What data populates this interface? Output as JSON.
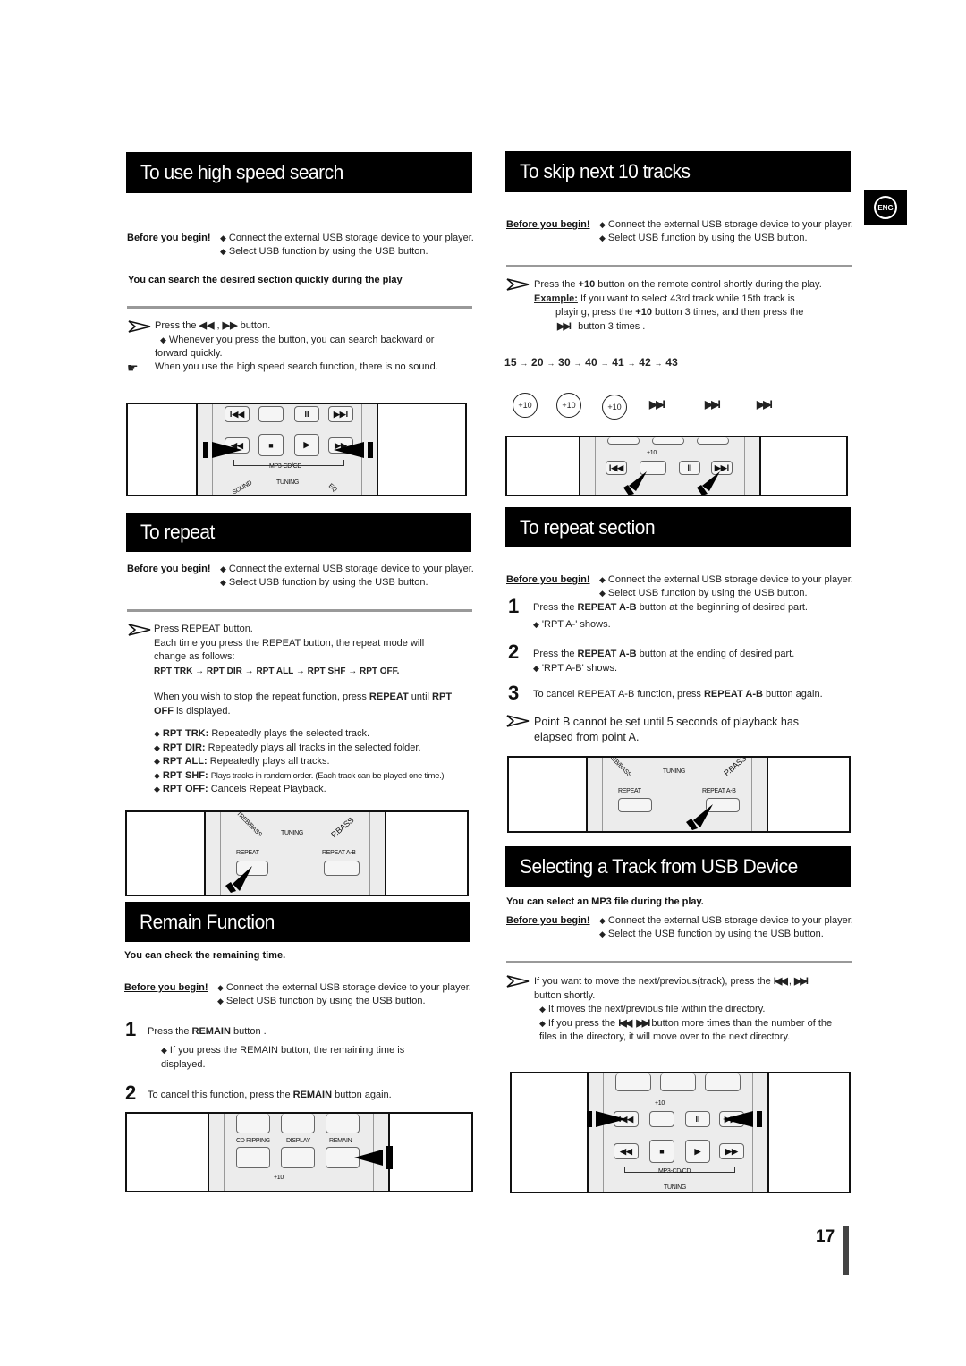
{
  "page_number": "17",
  "lang_badge": "ENG",
  "common": {
    "before_label": "Before you begin!",
    "connect": "Connect the external USB storage device to your player.",
    "select_usb": "Select USB function by using the USB button."
  },
  "high_speed": {
    "title": "To use high speed search",
    "note": "You can search the desired section quickly during the play",
    "press_pre": "Press the",
    "press_post": "button.",
    "bullet": "Whenever you press the button, you can search backward or forward quickly.",
    "hint": "When you use the high speed search function, there is no sound.",
    "remote": {
      "label_mp3": "MP3-CD/CD",
      "label_tuning": "TUNING",
      "label_sound": "SOUND",
      "label_eq": "EQ"
    }
  },
  "repeat": {
    "title": "To repeat",
    "line1": "Press REPEAT button.",
    "line2": "Each time you press the REPEAT button, the repeat mode will change as follows:",
    "sequence": "RPT TRK → RPT DIR → RPT ALL → RPT SHF → RPT OFF.",
    "stop_pre": "When you wish to stop the repeat function, press",
    "stop_b1": "REPEAT",
    "stop_mid": "until",
    "stop_b2": "RPT OFF",
    "stop_post": "is displayed.",
    "modes": [
      {
        "name": "RPT TRK:",
        "desc": "Repeatedly plays the selected track."
      },
      {
        "name": "RPT DIR:",
        "desc": "Repeatedly plays all tracks in the selected folder."
      },
      {
        "name": "RPT ALL:",
        "desc": "Repeatedly plays all tracks."
      },
      {
        "name": "RPT SHF:",
        "desc": "Plays tracks in random order. (Each track can be played one time.)"
      },
      {
        "name": "RPT OFF:",
        "desc": "Cancels Repeat Playback."
      }
    ],
    "remote": {
      "treb": "TREB/BASS",
      "tuning": "TUNING",
      "pbass": "P.BASS",
      "repeat": "REPEAT",
      "repeat_ab": "REPEAT A-B"
    }
  },
  "remain": {
    "title": "Remain Function",
    "note": "You can check the remaining time.",
    "step1_pre": "Press the",
    "step1_b": "REMAIN",
    "step1_post": "button .",
    "step1_bullet": "If you press the REMAIN button, the remaining time is displayed.",
    "step2_pre": "To cancel this function, press the",
    "step2_b": "REMAIN",
    "step2_post": "button again.",
    "remote": {
      "cd_ripping": "CD RIPPING",
      "display": "DISPLAY",
      "remain": "REMAIN",
      "plus10": "+10"
    }
  },
  "skip10": {
    "title": "To skip next 10 tracks",
    "press_pre": "Press the",
    "press_b": "+10",
    "press_post": "button on the remote control shortly during the play.",
    "example_label": "Example:",
    "example_text1": "If you want to select 43rd track while 15th track is",
    "example_text2_pre": "playing, press the",
    "example_text2_b": "+10",
    "example_text2_post": "button 3 times, and then press the",
    "example_text3": "button 3 times .",
    "sequence": [
      "15",
      "20",
      "30",
      "40",
      "41",
      "42",
      "43"
    ],
    "circle_label": "+10",
    "remote": {
      "plus10": "+10"
    }
  },
  "repeat_section": {
    "title": "To repeat section",
    "step1_pre": "Press the",
    "step1_b": "REPEAT A-B",
    "step1_post": "button at the beginning of desired part.",
    "step1_bullet": "'RPT A-' shows.",
    "step2_pre": "Press the",
    "step2_b": "REPEAT A-B",
    "step2_post": "button at the ending of desired part.",
    "step2_bullet": "'RPT A-B' shows.",
    "step3_pre": "To cancel REPEAT A-B function, press",
    "step3_b": "REPEAT A-B",
    "step3_post": "button again.",
    "note": "Point B cannot be set until 5 seconds of playback has elapsed from point A.",
    "remote": {
      "treb": "TREB/BASS",
      "tuning": "TUNING",
      "pbass": "P.BASS",
      "repeat": "REPEAT",
      "repeat_ab": "REPEAT A-B"
    }
  },
  "select_track": {
    "title": "Selecting a Track from USB Device",
    "note": "You can select an MP3 file during the play.",
    "select_usb": "Select the USB function by using the USB button.",
    "line1_pre": "If you want to move the next/previous(track), press the",
    "line1_post": "button shortly.",
    "bullet1": "It moves the next/previous file within the directory.",
    "bullet2_pre": "If you press the",
    "bullet2_post": "button more times than the number of the files in the directory, it will move over to the next directory.",
    "remote": {
      "plus10": "+10",
      "label_mp3": "MP3-CD/CD",
      "label_tuning": "TUNING"
    }
  }
}
